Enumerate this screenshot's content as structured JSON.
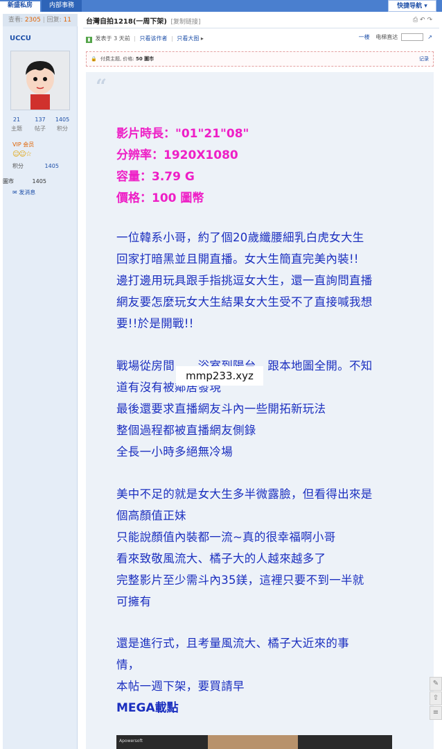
{
  "topbar": {
    "tab_active": "新盛私房",
    "tab_other": "内部事務",
    "quick_nav": "快捷导航 ▾"
  },
  "sidebar": {
    "views_label": "查看:",
    "views": "2305",
    "replies_label": "回复:",
    "replies": "11",
    "username": "UCCU",
    "stats": [
      {
        "value": "21",
        "label": "主题"
      },
      {
        "value": "137",
        "label": "帖子"
      },
      {
        "value": "1405",
        "label": "积分"
      }
    ],
    "vip": "VIP 会员",
    "medals": "☺☺☆",
    "credit_label": "积分",
    "credit_value": "1405",
    "coin_label": "圖市",
    "coin_value": "1405",
    "message": "发消息"
  },
  "post": {
    "title": "台灣自拍1218(一周下架)",
    "copy_link": "[复制链接]",
    "posted": "发表于 3 天前",
    "only_author": "只看该作者",
    "only_big": "只看大图",
    "floor": "一楼",
    "jump_label": "电梯直达",
    "pay_text": "付费主题, 价格:",
    "pay_amount": "50 圖市",
    "record": "记录"
  },
  "content": {
    "info": [
      "影片時長：\"01\"21\"08\"",
      "分辨率：1920X1080",
      "容量：3.79 G",
      "價格：100 圖幣"
    ],
    "para1": [
      "一位韓系小哥，約了個20歲纖腰細乳白虎女大生",
      "回家打暗黑並且開直播。女大生簡直完美內裝!!",
      "邊打邊用玩具跟手指挑逗女大生，還一直詢問直播",
      "網友要怎麼玩女大生結果女大生受不了直接喊我想",
      "要!!於是開戰!!"
    ],
    "para2": [
      "戰場從房間　　浴室到陽台，跟本地圖全開。不知",
      "道有沒有被鄰居發現",
      "最後還要求直播網友斗內一些開拓新玩法",
      "整個過程都被直播網友側錄",
      "全長一小時多絕無冷場"
    ],
    "para3": [
      "美中不足的就是女大生多半微露臉，但看得出來是",
      "個高顏值正妹",
      "只能說顏值內裝都一流~真的很幸福啊小哥",
      "看來致敬風流大、橘子大的人越來越多了",
      "完整影片至少需斗內35鎂，這裡只要不到一半就",
      "可擁有"
    ],
    "para4": [
      "還是進行式，且考量風流大、橘子大近來的事",
      "情，",
      "本帖一週下架，要買請早"
    ],
    "mega": "MEGA載點",
    "watermark": "mmp233.xyz",
    "preview_chip": "Apowersoft"
  },
  "colors": {
    "magenta": "#ee1fc6",
    "blue_text": "#1b2fbf",
    "topbar": "#4a7fcf",
    "sidebar_bg": "#e5edf7",
    "content_bg": "#edf2f8"
  }
}
